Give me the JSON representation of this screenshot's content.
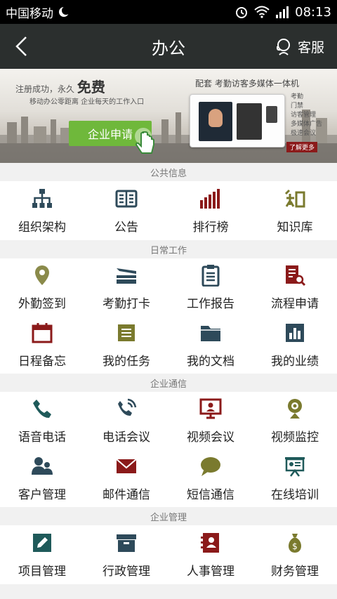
{
  "status": {
    "carrier": "中国移动",
    "time": "08:13"
  },
  "nav": {
    "title": "办公",
    "service_label": "客服"
  },
  "banner": {
    "slogan_prefix": "注册成功，永久",
    "slogan_emphasis": "免费",
    "sub": "移动办公零距离 企业每天的工作入口",
    "apply_label": "企业申请",
    "device_title": "配套 考勤访客多媒体一体机",
    "features": [
      "考勤",
      "门禁",
      "访客管理",
      "多媒体广告",
      "极速会议"
    ],
    "more_label": "了解更多"
  },
  "sections": [
    {
      "title": "公共信息",
      "items": [
        {
          "label": "组织架构",
          "icon": "org-chart-icon",
          "color": "#2e4a5a"
        },
        {
          "label": "公告",
          "icon": "book-icon",
          "color": "#2e4a5a"
        },
        {
          "label": "排行榜",
          "icon": "bar-chart-icon",
          "color": "#8b1a1a"
        },
        {
          "label": "知识库",
          "icon": "knowledge-icon",
          "color": "#7a7a2e"
        }
      ]
    },
    {
      "title": "日常工作",
      "items": [
        {
          "label": "外勤签到",
          "icon": "location-pin-icon",
          "color": "#8a8a4a"
        },
        {
          "label": "考勤打卡",
          "icon": "punch-card-icon",
          "color": "#2e4a5a"
        },
        {
          "label": "工作报告",
          "icon": "clipboard-icon",
          "color": "#2e4a5a"
        },
        {
          "label": "流程申请",
          "icon": "document-search-icon",
          "color": "#8b1a1a"
        },
        {
          "label": "日程备忘",
          "icon": "calendar-icon",
          "color": "#8b1a1a"
        },
        {
          "label": "我的任务",
          "icon": "task-list-icon",
          "color": "#7a7a2e"
        },
        {
          "label": "我的文档",
          "icon": "folder-icon",
          "color": "#2e4a5a"
        },
        {
          "label": "我的业绩",
          "icon": "performance-chart-icon",
          "color": "#2e4a5a"
        }
      ]
    },
    {
      "title": "企业通信",
      "items": [
        {
          "label": "语音电话",
          "icon": "phone-icon",
          "color": "#1f5a5a"
        },
        {
          "label": "电话会议",
          "icon": "conference-call-icon",
          "color": "#2e4a5a"
        },
        {
          "label": "视频会议",
          "icon": "video-conference-icon",
          "color": "#8b1a1a"
        },
        {
          "label": "视频监控",
          "icon": "webcam-icon",
          "color": "#7a7a2e"
        },
        {
          "label": "客户管理",
          "icon": "customers-icon",
          "color": "#2e4a5a"
        },
        {
          "label": "邮件通信",
          "icon": "mail-icon",
          "color": "#8b1a1a"
        },
        {
          "label": "短信通信",
          "icon": "chat-bubble-icon",
          "color": "#7a7a2e"
        },
        {
          "label": "在线培训",
          "icon": "presentation-icon",
          "color": "#1f5a5a"
        }
      ]
    },
    {
      "title": "企业管理",
      "items": [
        {
          "label": "项目管理",
          "icon": "edit-icon",
          "color": "#1f5a5a"
        },
        {
          "label": "行政管理",
          "icon": "archive-box-icon",
          "color": "#2e4a5a"
        },
        {
          "label": "人事管理",
          "icon": "address-book-icon",
          "color": "#8b1a1a"
        },
        {
          "label": "财务管理",
          "icon": "money-bag-icon",
          "color": "#7a7a2e"
        }
      ]
    }
  ]
}
